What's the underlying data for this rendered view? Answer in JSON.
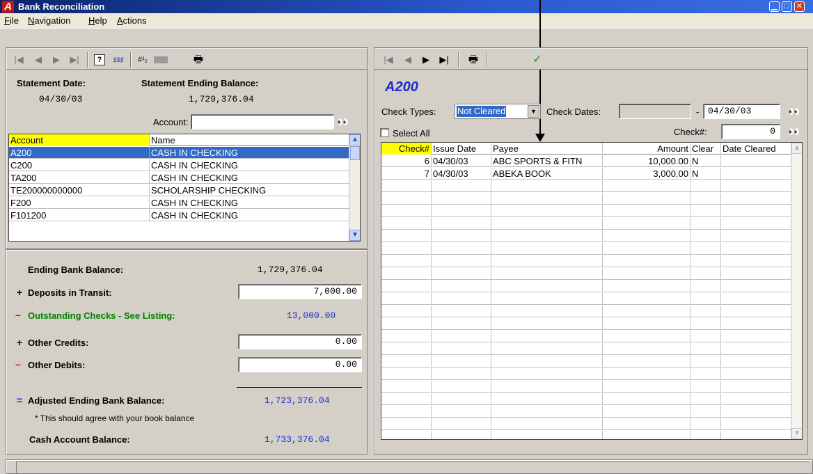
{
  "window": {
    "title": "Bank Reconciliation",
    "app_icon": "A"
  },
  "menu": [
    "File",
    "Navigation",
    "Help",
    "Actions"
  ],
  "statement": {
    "date_label": "Statement Date:",
    "date_value": "04/30/03",
    "balance_label": "Statement Ending Balance:",
    "balance_value": "1,729,376.04",
    "account_label": "Account:",
    "account_value": ""
  },
  "accounts": {
    "headers": [
      "Account",
      "Name"
    ],
    "rows": [
      [
        "A200",
        "CASH IN CHECKING"
      ],
      [
        "C200",
        "CASH IN CHECKING"
      ],
      [
        "TA200",
        "CASH IN CHECKING"
      ],
      [
        "TE200000000000",
        "SCHOLARSHIP CHECKING"
      ],
      [
        "F200",
        "CASH IN CHECKING"
      ],
      [
        "F101200",
        "CASH IN CHECKING"
      ]
    ]
  },
  "reconcile": {
    "ending_bank_balance_label": "Ending Bank Balance:",
    "ending_bank_balance_value": "1,729,376.04",
    "deposits_label": "Deposits in Transit:",
    "deposits_value": "7,000.00",
    "outstanding_label": "Outstanding Checks - See Listing:",
    "outstanding_value": "13,000.00",
    "other_credits_label": "Other Credits:",
    "other_credits_value": "0.00",
    "other_debits_label": "Other Debits:",
    "other_debits_value": "0.00",
    "adjusted_label": "Adjusted Ending Bank Balance:",
    "adjusted_value": "1,723,376.04",
    "note": "* This should agree with your book balance",
    "cash_account_label": "Cash Account Balance:",
    "cash_account_value": "1,733,376.04",
    "plus_sign": "+",
    "minus_sign": "–",
    "equals_sign": "="
  },
  "checks": {
    "account_title": "A200",
    "check_types_label": "Check Types:",
    "check_types_value": "Not Cleared",
    "check_dates_label": "Check Dates:",
    "check_dates_from": "",
    "check_dates_dash": "-",
    "check_dates_to": "04/30/03",
    "select_all_label": "Select All",
    "check_num_label": "Check#:",
    "check_num_value": "0",
    "headers": [
      "Check#",
      "Issue Date",
      "Payee",
      "Amount",
      "Clear",
      "Date Cleared"
    ],
    "rows": [
      [
        "6",
        "04/30/03",
        "ABC SPORTS & FITN",
        "10,000.00",
        "N",
        ""
      ],
      [
        "7",
        "04/30/03",
        "ABEKA BOOK",
        "3,000.00",
        "N",
        ""
      ]
    ]
  },
  "colors": {
    "header_highlight": "#ffff00",
    "selected_row": "#316ac5",
    "accent_blue": "#1a2cd8",
    "green_label": "#008000"
  }
}
